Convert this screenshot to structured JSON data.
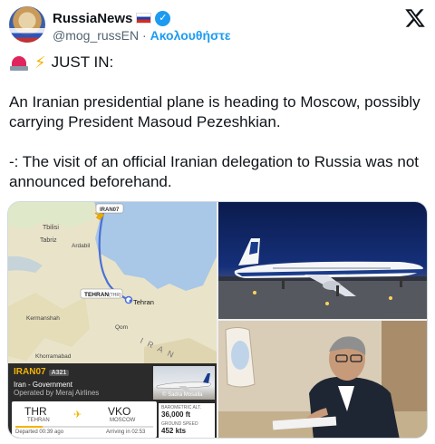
{
  "account": {
    "display_name": "RussiaNews",
    "handle": "@mog_russEN",
    "separator": "·",
    "follow_label": "Ακολουθήστε"
  },
  "tweet": {
    "line1": "JUST IN:",
    "para1": "An Iranian presidential plane is heading to Moscow, possibly carrying President Masoud Pezeshkian.",
    "para2": "-: The visit of an official Iranian delegation to Russia was not announced beforehand."
  },
  "map_labels": {
    "callsign_tag": "IRAN07",
    "tbilisi": "Tbilisi",
    "tabriz": "Tabriz",
    "ardabil": "Ardabil",
    "tehran_tag": "TEHRAN",
    "tehran_tag_code": "(THR)",
    "tehran": "Tehran",
    "kermanshah": "Kermanshah",
    "qom": "Qom",
    "iran": "IRAN",
    "khorramabad": "Khorramabad"
  },
  "flight": {
    "callsign": "IRAN07",
    "aircraft": "A321",
    "operator": "Iran - Government",
    "operated_by": "Operated by Meraj Airlines",
    "photo_credit": "© Sadra Mosalla",
    "from_code": "THR",
    "from_name": "TEHRAN",
    "to_code": "VKO",
    "to_name": "MOSCOW",
    "departed": "Departed 00:39 ago",
    "arriving": "Arriving in 02:53",
    "progress": 0.2,
    "alt_label": "BAROMETRIC ALT.",
    "alt_value": "36,000 ft",
    "speed_label": "GROUND SPEED",
    "speed_value": "452 kts"
  },
  "colors": {
    "link": "#1d9bf0",
    "muted": "#536471",
    "map_water": "#a9c7e6",
    "map_land": "#e9e4c9",
    "flight_path": "#4a6fd8",
    "fr_accent": "#f5b301"
  },
  "icons": {
    "verified": "verified-badge-icon",
    "x_logo": "x-logo-icon",
    "siren": "siren-emoji-icon",
    "bolt": "lightning-emoji-icon"
  }
}
